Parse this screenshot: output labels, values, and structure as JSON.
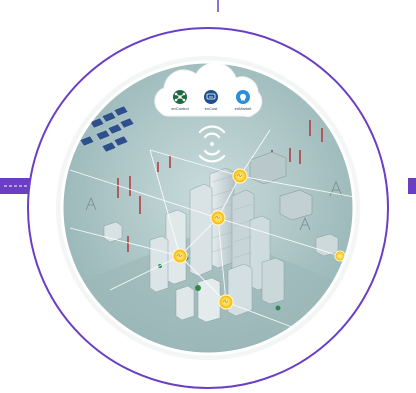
{
  "cloud": {
    "services": [
      {
        "label": "enControl",
        "icon": "network-nodes-icon",
        "color": "#1f6b3f"
      },
      {
        "label": "enCost",
        "icon": "cost-meter-icon",
        "color": "#1d4f8f"
      },
      {
        "label": "enMarket",
        "icon": "market-bulb-icon",
        "color": "#2a8fd8"
      }
    ]
  },
  "colors": {
    "ring": "#6a3fc4",
    "accent_bar": "#6a3fc4",
    "node": "#ffd23a",
    "node_glow": "#ffe27a",
    "scene_bg": "#a9c3c4",
    "cloud_fill": "#ffffff"
  },
  "decor": {
    "wireless_icon": "wireless-signal-icon",
    "nodes_icon": "energy-node-icon"
  }
}
